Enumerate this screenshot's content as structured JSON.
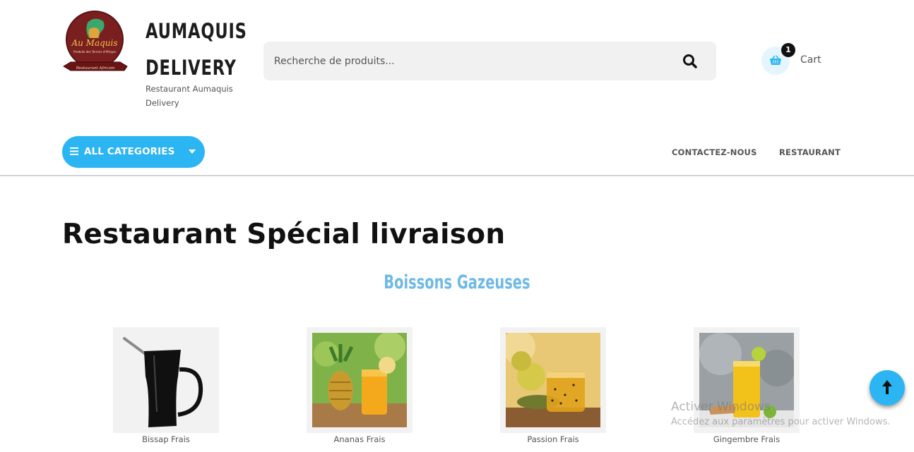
{
  "header": {
    "logo_text": "Au Maquis",
    "logo_subtext": "Produits des Terroirs d'Afrique",
    "logo_banner": "Restaurant Africain",
    "brand_line1": "AUMAQUIS",
    "brand_line2": "DELIVERY",
    "tagline": "Restaurant Aumaquis Delivery"
  },
  "search": {
    "placeholder": "Recherche de produits...",
    "icon": "search-icon"
  },
  "cart": {
    "count": "1",
    "label": "Cart",
    "icon": "basket-icon"
  },
  "nav": {
    "categories_label": "ALL CATEGORIES",
    "links": [
      "CONTACTEZ-NOUS",
      "RESTAURANT"
    ]
  },
  "main": {
    "page_title": "Restaurant Spécial livraison",
    "section_title": "Boissons Gazeuses",
    "products": [
      {
        "name": "Bissap Frais"
      },
      {
        "name": "Ananas Frais"
      },
      {
        "name": "Passion Frais"
      },
      {
        "name": "Gingembre Frais"
      }
    ]
  },
  "watermark": {
    "line1": "Activer Windows",
    "line2": "Accédez aux paramètres pour activer Windows."
  },
  "colors": {
    "accent": "#2bb5f2",
    "section_title": "#6fb9e6",
    "logo_bg": "#7a1f1f"
  }
}
